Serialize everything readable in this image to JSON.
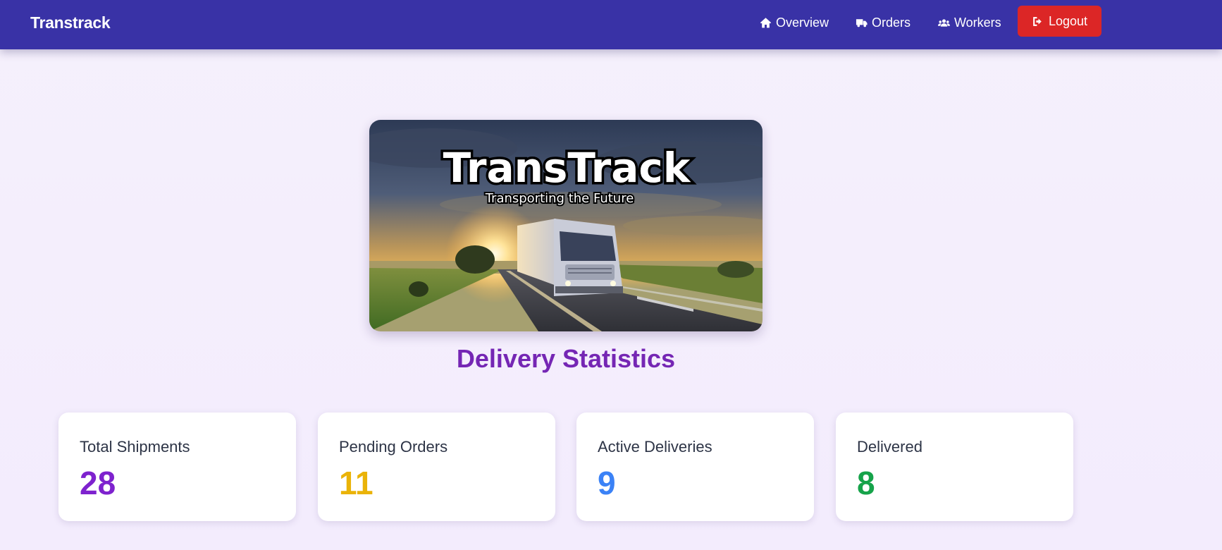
{
  "navbar": {
    "brand": "Transtrack",
    "links": [
      {
        "label": "Overview",
        "icon": "home-icon"
      },
      {
        "label": "Orders",
        "icon": "truck-icon"
      },
      {
        "label": "Workers",
        "icon": "users-icon"
      }
    ],
    "logout": {
      "label": "Logout",
      "icon": "sign-out-icon",
      "color": "#dc2626"
    },
    "background": "#3932a6"
  },
  "hero": {
    "logo_text": "TransTrack",
    "tagline": "Transporting the Future"
  },
  "stats": {
    "title": "Delivery Statistics",
    "title_color": "#7526b4",
    "cards": [
      {
        "label": "Total Shipments",
        "value": "28",
        "color": "#7e22ce"
      },
      {
        "label": "Pending Orders",
        "value": "11",
        "color": "#eab308"
      },
      {
        "label": "Active Deliveries",
        "value": "9",
        "color": "#3b82f6"
      },
      {
        "label": "Delivered",
        "value": "8",
        "color": "#16a34a"
      }
    ]
  }
}
